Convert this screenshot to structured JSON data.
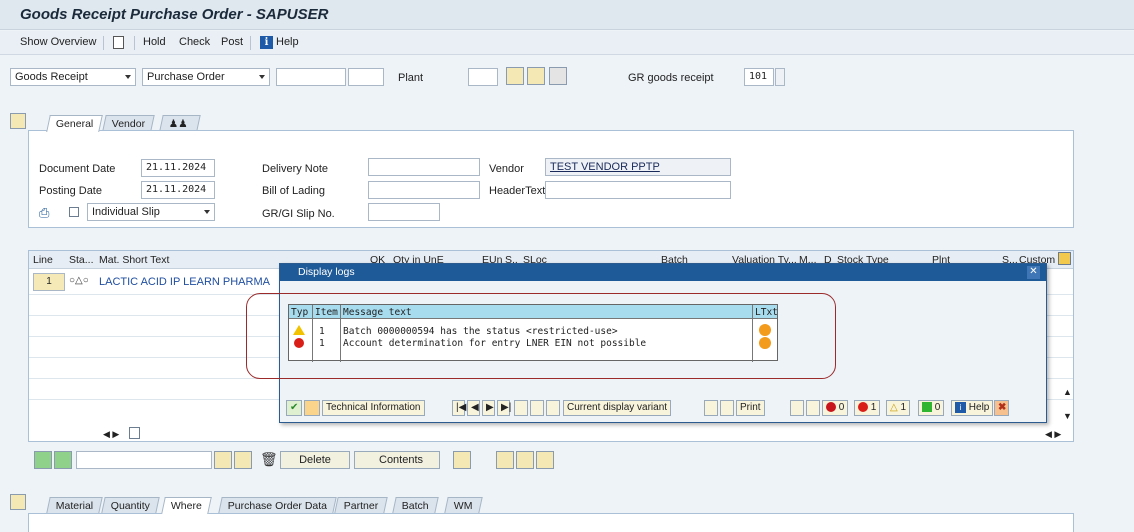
{
  "window": {
    "title": "Goods Receipt Purchase Order - SAPUSER"
  },
  "toolbar": {
    "show_overview": "Show Overview",
    "hold": "Hold",
    "check": "Check",
    "post": "Post",
    "help": "Help"
  },
  "header": {
    "action_select": "Goods Receipt",
    "ref_select": "Purchase Order",
    "plant_label": "Plant",
    "gr_label": "GR goods receipt",
    "movement_type": "101"
  },
  "tabs_top": [
    "General",
    "Vendor"
  ],
  "general": {
    "document_date_label": "Document Date",
    "document_date": "21.11.2024",
    "posting_date_label": "Posting Date",
    "posting_date": "21.11.2024",
    "slip_select": "Individual Slip",
    "delivery_note_label": "Delivery Note",
    "bill_of_lading_label": "Bill of Lading",
    "gr_slip_label": "GR/GI Slip No.",
    "vendor_label": "Vendor",
    "vendor_value": "TEST VENDOR PPTP",
    "header_text_label": "HeaderText"
  },
  "grid": {
    "columns": [
      "Line",
      "Sta...",
      "Mat. Short Text",
      "OK",
      "Qty in UnE",
      "EUn",
      "S..",
      "SLoc",
      "Batch",
      "Valuation Ty...",
      "M...",
      "D",
      "Stock Type",
      "Plnt",
      "S...",
      "Custom"
    ],
    "rows": [
      {
        "line": "1",
        "material": "LACTIC ACID IP LEARN PHARMA"
      }
    ]
  },
  "dialog": {
    "title": "Display logs",
    "columns": [
      "Typ",
      "Item",
      "Message text",
      "LTxt"
    ],
    "messages": [
      {
        "type": "warning",
        "item": "1",
        "text": "Batch 0000000594 has the status <restricted-use>"
      },
      {
        "type": "error",
        "item": "1",
        "text": "Account determination for entry LNER EIN not possible"
      }
    ],
    "technical_info": "Technical Information",
    "display_variant": "Current display variant",
    "print": "Print",
    "stop_count": "0",
    "error_count": "1",
    "warning_count": "1",
    "success_count": "0",
    "help": "Help"
  },
  "bottom": {
    "delete": "Delete",
    "contents": "Contents"
  },
  "tabs_bottom": [
    "Material",
    "Quantity",
    "Where",
    "Purchase Order Data",
    "Partner",
    "Batch",
    "WM"
  ]
}
